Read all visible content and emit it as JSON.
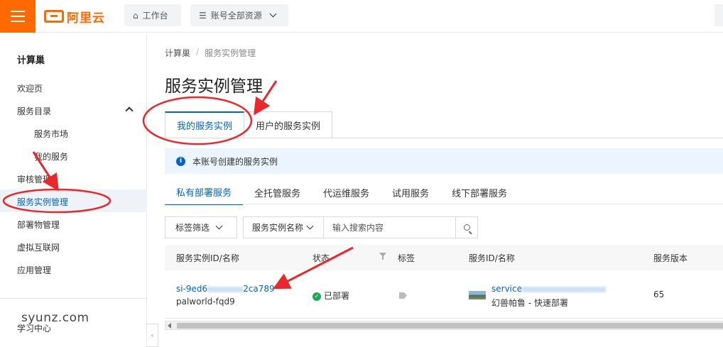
{
  "topbar": {
    "logo_text": "阿里云",
    "workbench_label": "工作台",
    "resources_label": "账号全部资源"
  },
  "sidebar": {
    "title": "计算巢",
    "items": [
      {
        "label": "欢迎页"
      },
      {
        "label": "服务目录"
      },
      {
        "label": "服务市场"
      },
      {
        "label": "我的服务"
      },
      {
        "label": "审核管理"
      },
      {
        "label": "服务实例管理"
      },
      {
        "label": "部署物管理"
      },
      {
        "label": "虚拟互联网"
      },
      {
        "label": "应用管理"
      },
      {
        "label": "学习中心"
      }
    ],
    "watermark": "syunz.com"
  },
  "main": {
    "breadcrumb": [
      "计算巢",
      "服务实例管理"
    ],
    "title": "服务实例管理",
    "tabs": [
      {
        "label": "我的服务实例"
      },
      {
        "label": "用户的服务实例"
      }
    ],
    "notice": "本账号创建的服务实例",
    "subtabs": [
      {
        "label": "私有部署服务"
      },
      {
        "label": "全托管服务"
      },
      {
        "label": "代运维服务"
      },
      {
        "label": "试用服务"
      },
      {
        "label": "线下部署服务"
      }
    ],
    "filter": {
      "tag_filter": "标签筛选",
      "search_type": "服务实例名称",
      "search_placeholder": "输入搜索内容"
    },
    "table": {
      "headers": [
        "服务实例ID/名称",
        "状态",
        "标签",
        "服务ID/名称",
        "服务版本"
      ],
      "rows": [
        {
          "instance_id_prefix": "si-9ed6",
          "instance_id_suffix": "2ca789",
          "instance_name": "palworld-fqd9",
          "status": "已部署",
          "service_id_prefix": "service",
          "service_name": "幻兽帕鲁 - 快速部署",
          "version": "65"
        }
      ]
    }
  },
  "colors": {
    "brand": "#ff6a00",
    "link": "#0064c8",
    "annotation": "#e8282c",
    "status_ok": "#1aaa55"
  }
}
